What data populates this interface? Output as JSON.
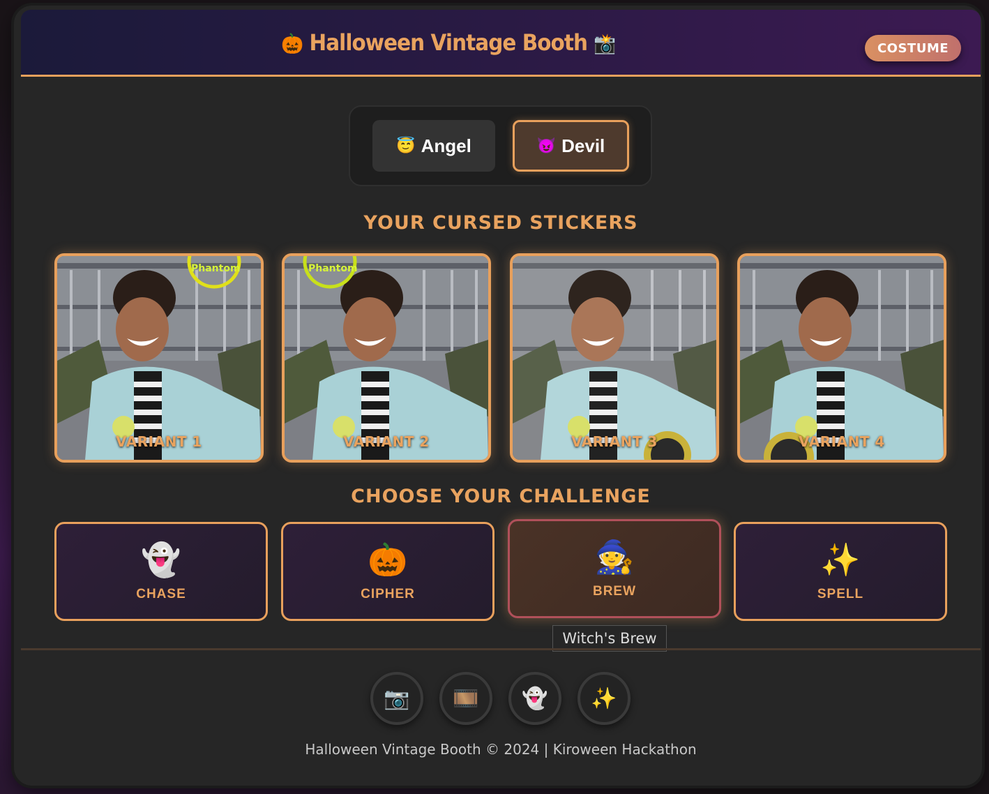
{
  "header": {
    "title_prefix_icon": "🎃",
    "title": "Halloween Vintage Booth",
    "title_suffix_icon": "📸",
    "costume_label": "COSTUME"
  },
  "mode": {
    "angel_icon": "😇",
    "angel_label": "Angel",
    "devil_icon": "😈",
    "devil_label": "Devil",
    "selected": "Devil"
  },
  "stickers": {
    "title": "YOUR CURSED STICKERS",
    "items": [
      {
        "label": "VARIANT 1",
        "overlay": "Phantom"
      },
      {
        "label": "VARIANT 2",
        "overlay": "Phantom"
      },
      {
        "label": "VARIANT 3"
      },
      {
        "label": "VARIANT 4"
      }
    ]
  },
  "challenge": {
    "title": "CHOOSE YOUR CHALLENGE",
    "items": [
      {
        "icon": "👻",
        "label": "CHASE"
      },
      {
        "icon": "🎃",
        "label": "CIPHER"
      },
      {
        "icon": "🧙",
        "label": "BREW"
      },
      {
        "icon": "✨",
        "label": "SPELL"
      }
    ],
    "selected": "BREW",
    "tooltip": "Witch's Brew"
  },
  "footer": {
    "icons": [
      "📷",
      "🎞️",
      "👻",
      "✨"
    ],
    "icon_names": [
      "camera-icon",
      "film-icon",
      "ghost-icon",
      "sparkles-icon"
    ],
    "text": "Halloween Vintage Booth © 2024 | Kiroween Hackathon"
  },
  "colors": {
    "accent": "#e8a05c",
    "background": "#262626"
  }
}
